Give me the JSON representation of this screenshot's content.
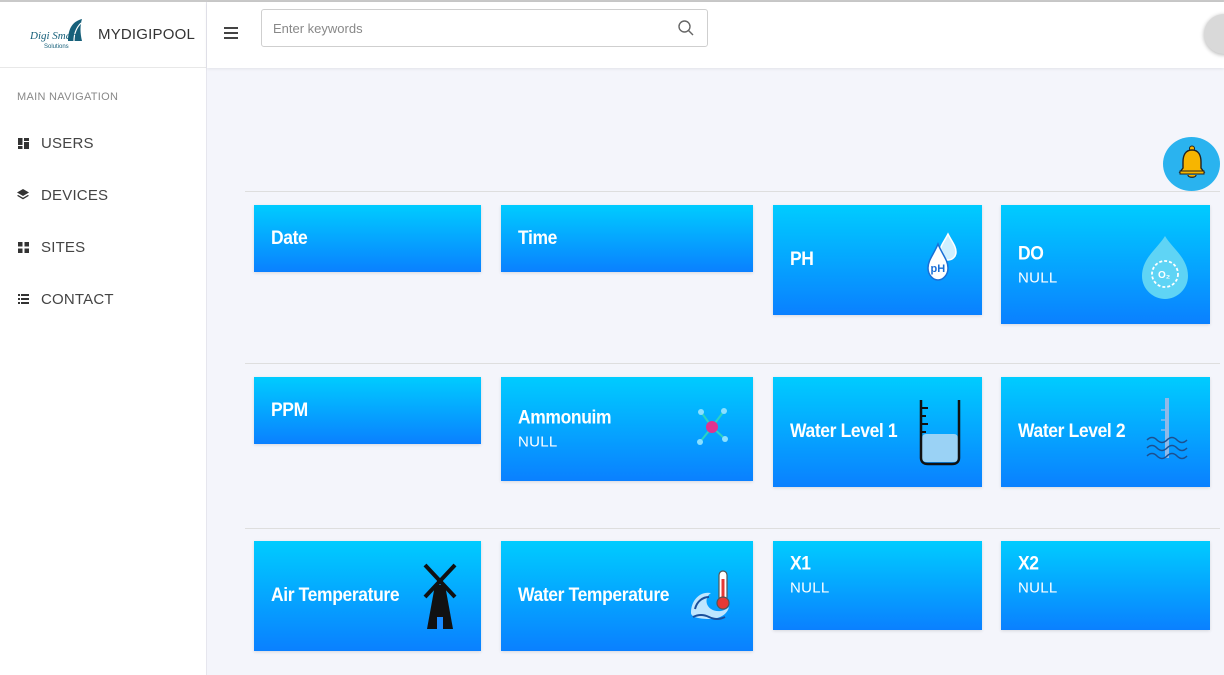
{
  "app": {
    "brand": "MYDIGIPOOL",
    "logo_text": "Digi Smart",
    "logo_subtext": "Solutions"
  },
  "sidebar": {
    "heading": "MAIN NAVIGATION",
    "items": [
      {
        "label": "USERS",
        "icon": "dashboard-icon"
      },
      {
        "label": "DEVICES",
        "icon": "layers-icon"
      },
      {
        "label": "SITES",
        "icon": "grid-icon"
      },
      {
        "label": "CONTACT",
        "icon": "list-icon"
      }
    ]
  },
  "search": {
    "placeholder": "Enter keywords"
  },
  "cards": [
    {
      "title": "Date",
      "value": ""
    },
    {
      "title": "Time",
      "value": ""
    },
    {
      "title": "PH",
      "value": "",
      "icon": "ph-drop-icon"
    },
    {
      "title": "DO",
      "value": "NULL",
      "icon": "oxygen-icon"
    },
    {
      "title": "PPM",
      "value": ""
    },
    {
      "title": "Ammonuim",
      "value": "NULL",
      "icon": "molecule-icon"
    },
    {
      "title": "Water Level 1",
      "value": "",
      "icon": "beaker-icon"
    },
    {
      "title": "Water Level 2",
      "value": "",
      "icon": "level-gauge-icon"
    },
    {
      "title": "Air Temperature",
      "value": "",
      "icon": "windmill-icon"
    },
    {
      "title": "Water Temperature",
      "value": "",
      "icon": "thermometer-wave-icon"
    },
    {
      "title": "X1",
      "value": "NULL"
    },
    {
      "title": "X2",
      "value": "NULL"
    }
  ],
  "colors": {
    "card_top": "#00ccff",
    "card_bottom": "#0a80ff",
    "bell_bg": "#2ab3ef",
    "bell": "#f7b500"
  }
}
